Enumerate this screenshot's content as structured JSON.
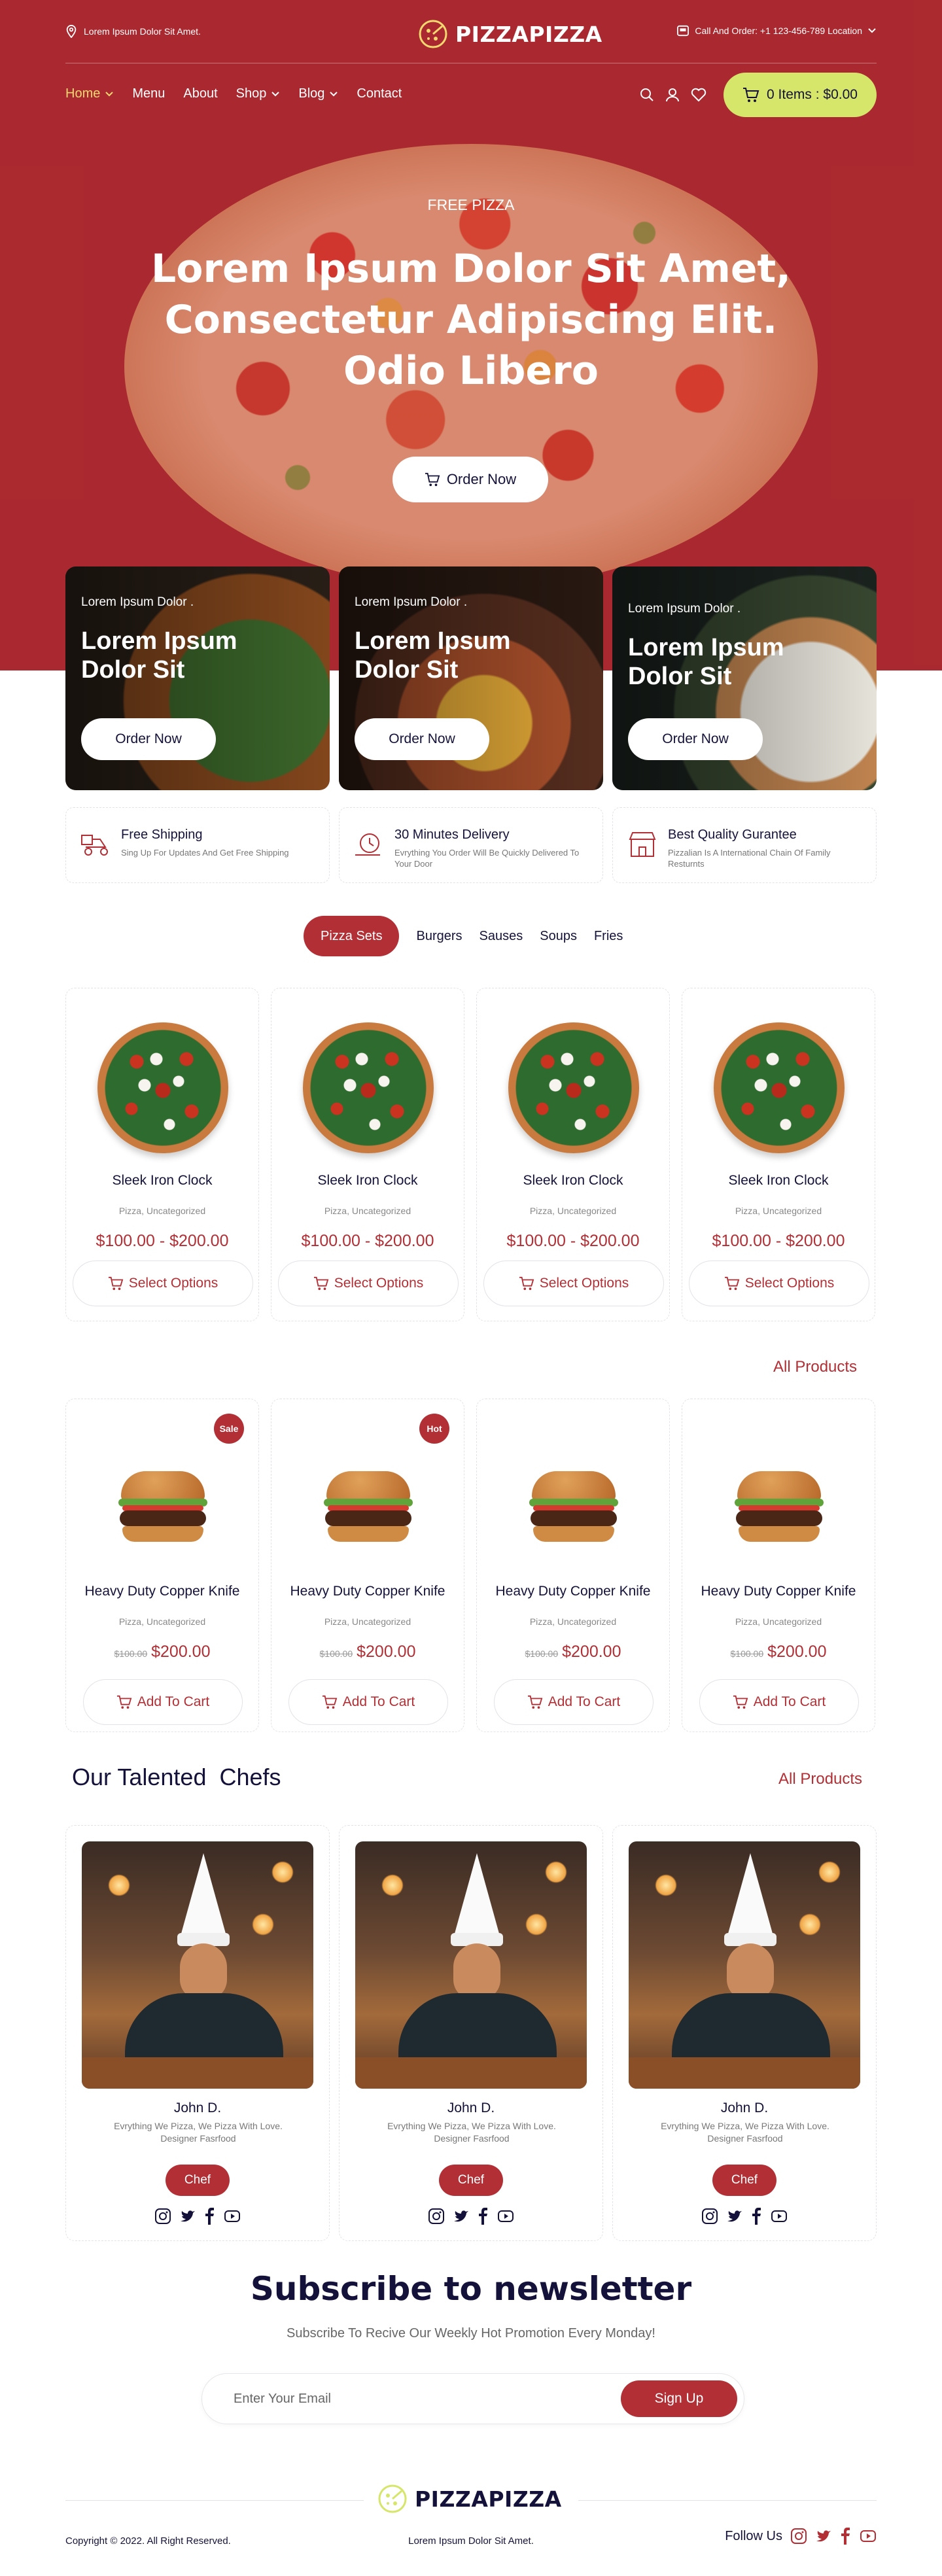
{
  "topbar": {
    "location_text": "Lorem Ipsum Dolor Sit Amet.",
    "call_text": "Call And Order: +1 123-456-789 Location"
  },
  "brand": {
    "name": "PIZZAPIZZA"
  },
  "nav": {
    "items": [
      {
        "label": "Home",
        "has_dropdown": true,
        "active": true
      },
      {
        "label": "Menu",
        "has_dropdown": false
      },
      {
        "label": "About",
        "has_dropdown": false
      },
      {
        "label": "Shop",
        "has_dropdown": true
      },
      {
        "label": "Blog",
        "has_dropdown": true
      },
      {
        "label": "Contact",
        "has_dropdown": false
      }
    ],
    "cart_label": "0 Items : $0.00"
  },
  "hero": {
    "eyebrow": "FREE PIZZA",
    "title_line1": "Lorem Ipsum Dolor Sit Amet,",
    "title_line2": "Consectetur Adipiscing Elit.",
    "title_line3": "Odio Libero",
    "button_label": "Order Now"
  },
  "promos": [
    {
      "small": "Lorem Ipsum Dolor .",
      "big": "Lorem Ipsum Dolor Sit",
      "button": "Order Now"
    },
    {
      "small": "Lorem Ipsum Dolor .",
      "big": "Lorem Ipsum Dolor Sit",
      "button": "Order Now"
    },
    {
      "small": "Lorem Ipsum Dolor .",
      "big": "Lorem Ipsum Dolor Sit",
      "button": "Order Now"
    }
  ],
  "features": [
    {
      "title": "Free Shipping",
      "desc": "Sing Up For Updates And Get Free Shipping",
      "icon": "delivery-scooter-icon"
    },
    {
      "title": "30 Minutes Delivery",
      "desc": "Evrything You Order Will Be Quickly Delivered To Your Door",
      "icon": "timer-icon"
    },
    {
      "title": "Best Quality Gurantee",
      "desc": "Pizzalian Is A International Chain Of Family Resturnts",
      "icon": "store-icon"
    }
  ],
  "tabs": {
    "active": "Pizza Sets",
    "items": [
      "Burgers",
      "Sauses",
      "Soups",
      "Fries"
    ]
  },
  "pizza_products": [
    {
      "name": "Sleek Iron Clock",
      "category": "Pizza, Uncategorized",
      "price": "$100.00 - $200.00",
      "button": "Select Options"
    },
    {
      "name": "Sleek Iron Clock",
      "category": "Pizza, Uncategorized",
      "price": "$100.00 - $200.00",
      "button": "Select Options"
    },
    {
      "name": "Sleek Iron Clock",
      "category": "Pizza, Uncategorized",
      "price": "$100.00 - $200.00",
      "button": "Select Options"
    },
    {
      "name": "Sleek Iron Clock",
      "category": "Pizza, Uncategorized",
      "price": "$100.00 - $200.00",
      "button": "Select Options"
    }
  ],
  "all_products_label": "All Products",
  "burger_products": [
    {
      "name": "Heavy Duty Copper Knife",
      "category": "Pizza, Uncategorized",
      "old_price": "$100.00",
      "price": "$200.00",
      "button": "Add To Cart",
      "badge": "Sale"
    },
    {
      "name": "Heavy Duty Copper Knife",
      "category": "Pizza, Uncategorized",
      "old_price": "$100.00",
      "price": "$200.00",
      "button": "Add To Cart",
      "badge": "Hot"
    },
    {
      "name": "Heavy Duty Copper Knife",
      "category": "Pizza, Uncategorized",
      "old_price": "$100.00",
      "price": "$200.00",
      "button": "Add To Cart",
      "badge": ""
    },
    {
      "name": "Heavy Duty Copper Knife",
      "category": "Pizza, Uncategorized",
      "old_price": "$100.00",
      "price": "$200.00",
      "button": "Add To Cart",
      "badge": ""
    }
  ],
  "chefs_section": {
    "title": "Our Talented  Chefs",
    "link": "All Products"
  },
  "chefs": [
    {
      "name": "John D.",
      "desc": "Evrything We Pizza, We Pizza With Love. Designer Fasrfood",
      "role": "Chef"
    },
    {
      "name": "John D.",
      "desc": "Evrything We Pizza, We Pizza With Love. Designer Fasrfood",
      "role": "Chef"
    },
    {
      "name": "John D.",
      "desc": "Evrything We Pizza, We Pizza With Love. Designer Fasrfood",
      "role": "Chef"
    }
  ],
  "newsletter": {
    "title": "Subscribe to newsletter",
    "subtitle": "Subscribe To Recive Our Weekly Hot Promotion Every Monday!",
    "placeholder": "Enter Your Email",
    "button": "Sign Up"
  },
  "footer": {
    "copyright": "Copyright © 2022. All Right Reserved.",
    "middle": "Lorem Ipsum Dolor Sit Amet.",
    "follow_label": "Follow Us"
  },
  "colors": {
    "brand_red": "#b22f35",
    "cart_lime": "#d6e66a",
    "navy": "#14123a",
    "nav_active": "#f2d86f"
  }
}
